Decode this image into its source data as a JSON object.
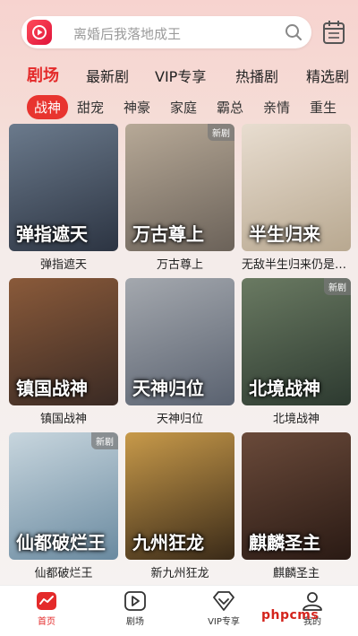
{
  "search": {
    "placeholder": "离婚后我落地成王"
  },
  "tabs": [
    {
      "label": "剧场"
    },
    {
      "label": "最新剧"
    },
    {
      "label": "VIP专享"
    },
    {
      "label": "热播剧"
    },
    {
      "label": "精选剧"
    }
  ],
  "sub_tabs": [
    {
      "label": "战神"
    },
    {
      "label": "甜宠"
    },
    {
      "label": "神豪"
    },
    {
      "label": "家庭"
    },
    {
      "label": "霸总"
    },
    {
      "label": "亲情"
    },
    {
      "label": "重生"
    }
  ],
  "dramas": [
    {
      "title": "弹指遮天",
      "poster_text": "弹指遮天",
      "badge": "",
      "colors": [
        "#2c3442",
        "#6b7a8c"
      ]
    },
    {
      "title": "万古尊上",
      "poster_text": "万古尊上",
      "badge": "新剧",
      "colors": [
        "#6b6259",
        "#b7a997"
      ]
    },
    {
      "title": "无敌半生归来仍是少年",
      "poster_text": "半生归来",
      "badge": "",
      "colors": [
        "#b8a890",
        "#e8ddd0"
      ]
    },
    {
      "title": "镇国战神",
      "poster_text": "镇国战神",
      "badge": "",
      "colors": [
        "#3a2a24",
        "#8a5a3a"
      ]
    },
    {
      "title": "天神归位",
      "poster_text": "天神归位",
      "badge": "",
      "colors": [
        "#5a6270",
        "#a4a8ae"
      ]
    },
    {
      "title": "北境战神",
      "poster_text": "北境战神",
      "badge": "新剧",
      "colors": [
        "#2d3a30",
        "#6a7a62"
      ]
    },
    {
      "title": "仙都破烂王",
      "poster_text": "仙都破烂王",
      "badge": "新剧",
      "colors": [
        "#6a8aa0",
        "#c8d6de"
      ]
    },
    {
      "title": "新九州狂龙",
      "poster_text": "九州狂龙",
      "badge": "",
      "colors": [
        "#3a2a18",
        "#c89a4a"
      ]
    },
    {
      "title": "麒麟圣主",
      "poster_text": "麒麟圣主",
      "badge": "",
      "colors": [
        "#2a1a14",
        "#6a4a3a"
      ]
    }
  ],
  "bottom_nav": [
    {
      "label": "首页",
      "icon": "home-icon"
    },
    {
      "label": "剧场",
      "icon": "play-icon"
    },
    {
      "label": "VIP专享",
      "icon": "diamond-icon"
    },
    {
      "label": "我的",
      "icon": "user-icon"
    }
  ],
  "watermark": "phpcms",
  "accent_color": "#e42a2a"
}
